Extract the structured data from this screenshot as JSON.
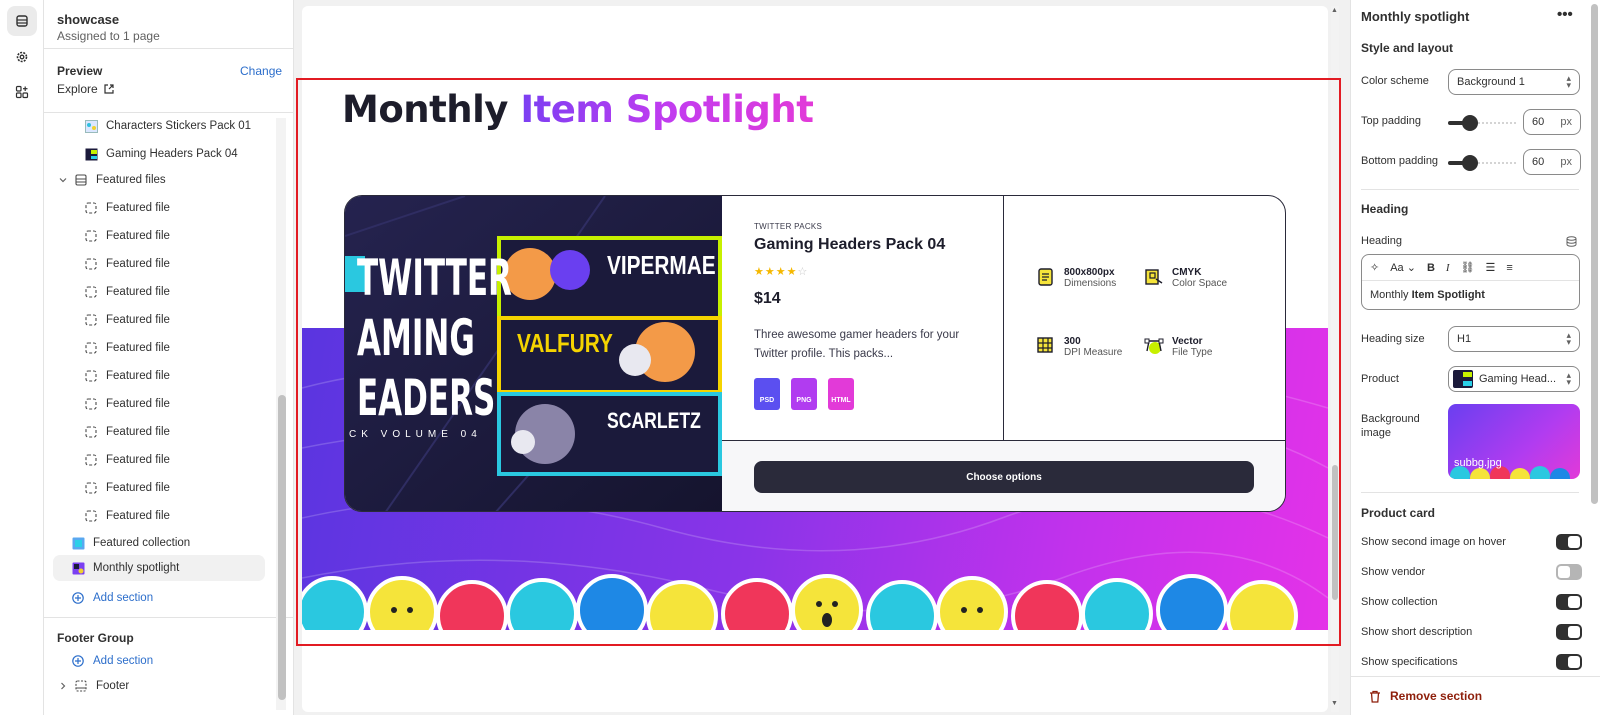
{
  "left_panel": {
    "title": "showcase",
    "subtitle": "Assigned to 1 page",
    "preview_label": "Preview",
    "change_label": "Change",
    "explore_label": "Explore",
    "tree": [
      {
        "label": "Characters Stickers Pack 01",
        "type": "image-item"
      },
      {
        "label": "Gaming Headers Pack 04",
        "type": "image-item"
      },
      {
        "label": "Featured files",
        "type": "group"
      },
      {
        "label": "Featured file"
      },
      {
        "label": "Featured file"
      },
      {
        "label": "Featured file"
      },
      {
        "label": "Featured file"
      },
      {
        "label": "Featured file"
      },
      {
        "label": "Featured file"
      },
      {
        "label": "Featured file"
      },
      {
        "label": "Featured file"
      },
      {
        "label": "Featured file"
      },
      {
        "label": "Featured file"
      },
      {
        "label": "Featured file"
      },
      {
        "label": "Featured file"
      },
      {
        "label": "Featured collection"
      },
      {
        "label": "Monthly spotlight"
      },
      {
        "label": "Add section"
      }
    ],
    "footer_group_label": "Footer Group",
    "footer_add_section": "Add section",
    "footer_label": "Footer"
  },
  "preview": {
    "heading_plain": "Monthly",
    "heading_accent": "Item Spotlight",
    "image_text": {
      "line1": "TWITTER",
      "line2": "AMING",
      "line3": "EADERS",
      "line4": "CK VOLUME 04",
      "banner1": "VIPERMAE",
      "banner2": "VALFURY",
      "banner3": "SCARLETZ"
    },
    "vendor": "TWITTER PACKS",
    "product_title": "Gaming Headers Pack 04",
    "rating": 4,
    "rating_max": 5,
    "price": "$14",
    "description_line1": "Three awesome gamer headers for your",
    "description_line2": "Twitter profile. This packs...",
    "file_types": [
      "PSD",
      "PNG",
      "HTML"
    ],
    "specs": [
      {
        "title": "800x800px",
        "sub": "Dimensions"
      },
      {
        "title": "CMYK",
        "sub": "Color Space"
      },
      {
        "title": "300",
        "sub": "DPI Measure"
      },
      {
        "title": "Vector",
        "sub": "File Type"
      }
    ],
    "button_label": "Choose options"
  },
  "right_panel": {
    "title": "Monthly spotlight",
    "more_label": "•••",
    "style_layout": "Style and layout",
    "color_scheme_label": "Color scheme",
    "color_scheme_value": "Background 1",
    "top_padding_label": "Top padding",
    "top_padding_value": "60",
    "bottom_padding_label": "Bottom padding",
    "bottom_padding_value": "60",
    "unit": "px",
    "heading_section": "Heading",
    "heading_field_label": "Heading",
    "heading_plain": "Monthly",
    "heading_bold": "Item Spotlight",
    "heading_size_label": "Heading size",
    "heading_size_value": "H1",
    "product_label": "Product",
    "product_value": "Gaming Head...",
    "bg_label_1": "Background",
    "bg_label_2": "image",
    "bg_filename": "subbg.jpg",
    "product_card_section": "Product card",
    "toggles": [
      {
        "label": "Show second image on hover",
        "on": true
      },
      {
        "label": "Show vendor",
        "on": false
      },
      {
        "label": "Show collection",
        "on": true
      },
      {
        "label": "Show short description",
        "on": true
      },
      {
        "label": "Show specifications",
        "on": true
      }
    ],
    "remove_label": "Remove section"
  },
  "colors": {
    "accent_blue": "#2c6ecb",
    "highlight_red": "#e21b23",
    "danger": "#8e1f0b",
    "gradient_start": "#7b3ff2",
    "gradient_end": "#e23ad8"
  }
}
